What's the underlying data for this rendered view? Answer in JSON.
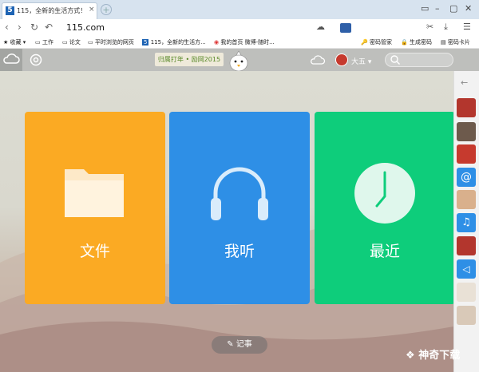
{
  "browser": {
    "tab_title": "115，全新的生活方式！",
    "tab_favicon": "5",
    "new_tab": "+",
    "url": "115.com",
    "window_controls": [
      "▭",
      "–",
      "▢",
      "✕"
    ]
  },
  "toolbar": {
    "scissors_icon": "✂",
    "download_icon": "⤓",
    "menu_icon": "☰"
  },
  "bookmarks": {
    "favorites": "收藏",
    "items": [
      "工作",
      "论文",
      "平时浏览的网页",
      "115，全新的生活方...",
      "我的首页 微博-随时..."
    ],
    "right_items": [
      "密码管家",
      "生成密码",
      "密码卡片"
    ]
  },
  "app": {
    "slogan": "归属打年 • 励网2015",
    "user_name": "大五",
    "tiles": [
      {
        "label": "文件",
        "color": "#fbaa23"
      },
      {
        "label": "我听",
        "color": "#2e8fe6"
      },
      {
        "label": "最近",
        "color": "#0ecd7b"
      }
    ],
    "notes_button": "记事"
  },
  "watermark": "神奇下载",
  "colors": {
    "accent_blue": "#2e8fe6",
    "accent_orange": "#fbaa23",
    "accent_green": "#0ecd7b"
  }
}
